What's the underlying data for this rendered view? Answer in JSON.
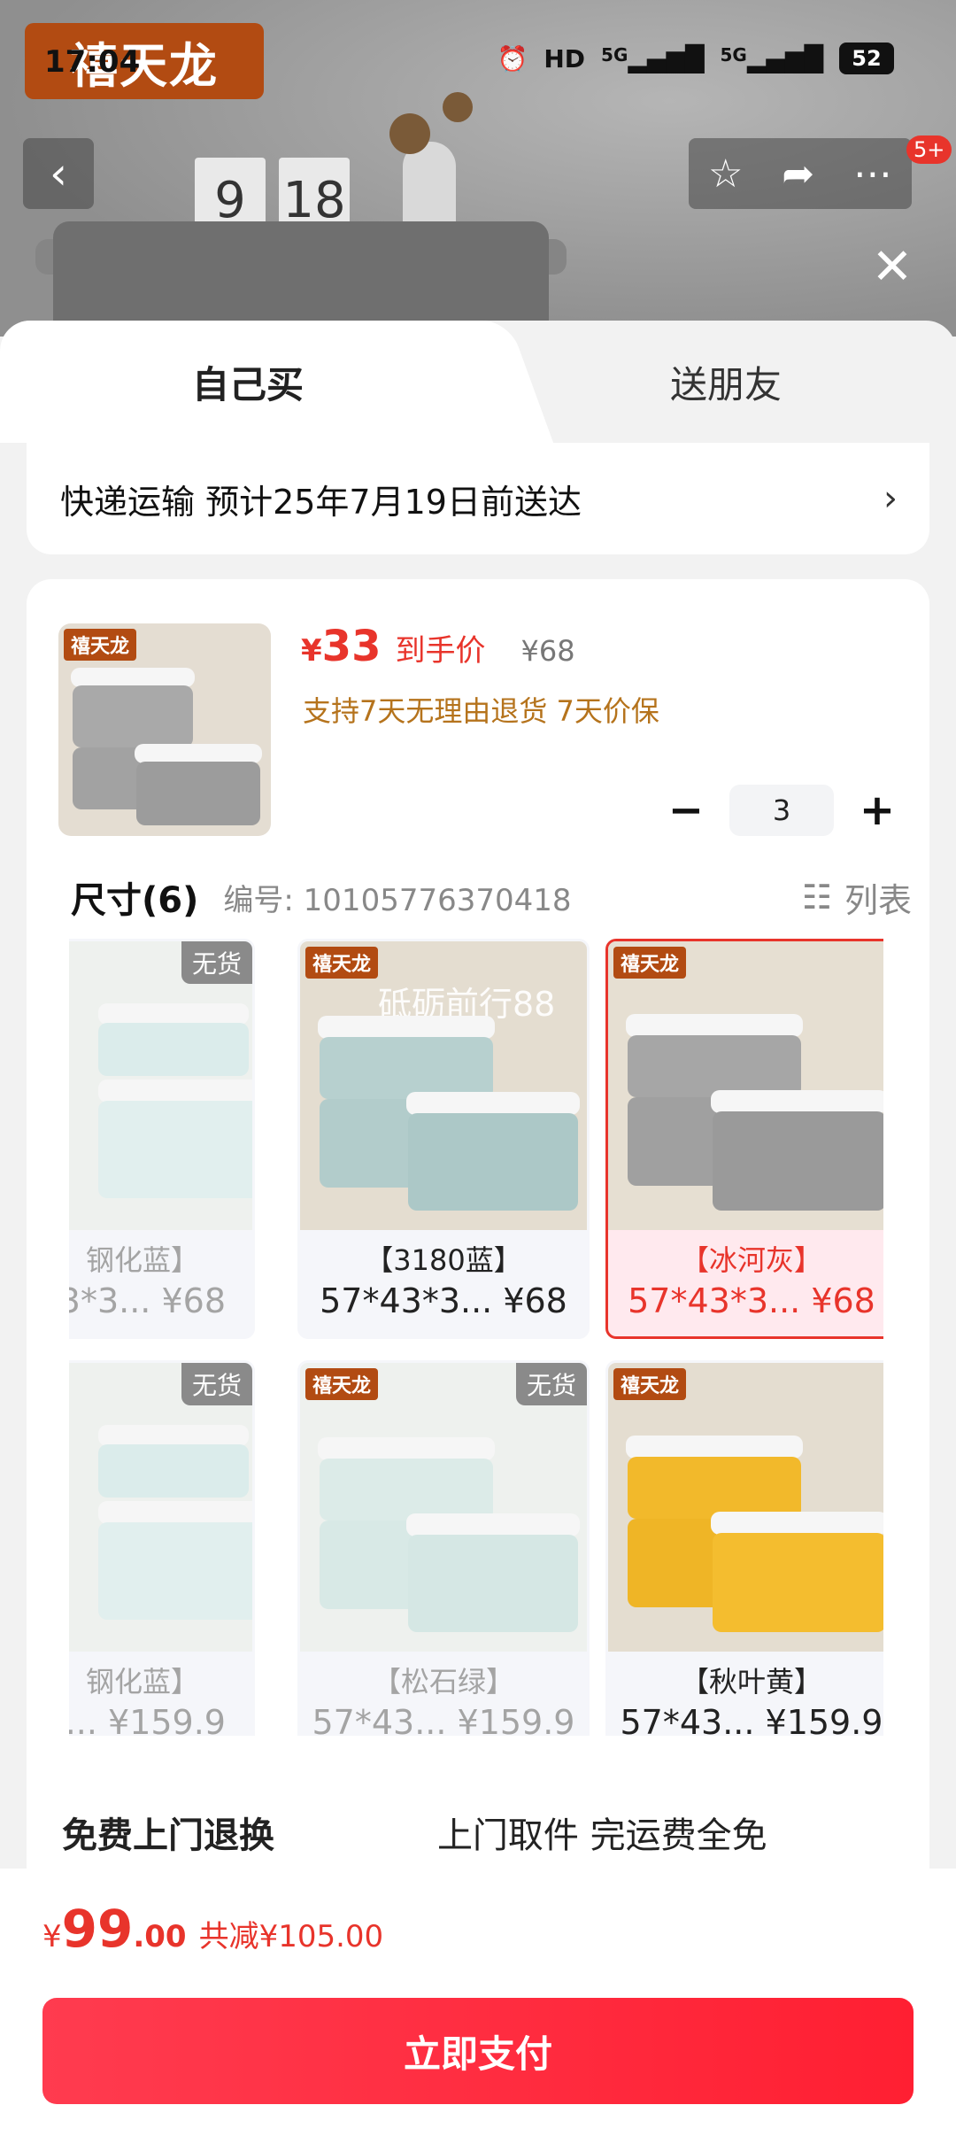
{
  "status_bar": {
    "time": "17:04",
    "hd": "HD",
    "net1": "5G",
    "net2": "5G",
    "battery": "52"
  },
  "header": {
    "brand": "禧天龙",
    "clock_hour": "9",
    "clock_min": "18",
    "notif_badge": "5+"
  },
  "tabs": [
    {
      "label": "自己买",
      "active": true
    },
    {
      "label": "送朋友",
      "active": false
    }
  ],
  "shipping": {
    "text": "快递运输 预计25年7月19日前送达"
  },
  "product": {
    "price_yen": "¥",
    "price": "33",
    "price_tag": "到手价",
    "original_price": "¥68",
    "guarantee": "支持7天无理由退货 7天价保",
    "quantity": "3"
  },
  "size_section": {
    "title": "尺寸(6)",
    "code": "编号: 10105776370418",
    "list_label": "列表"
  },
  "options": [
    {
      "line1": "钢化蓝】",
      "line2": "3*3... ¥68",
      "no_stock": "无货",
      "state": "dim"
    },
    {
      "line1": "【3180蓝】",
      "line2": "57*43*3... ¥68",
      "watermark": "砥砺前行88",
      "state": "normal"
    },
    {
      "line1": "【冰河灰】",
      "line2": "57*43*3... ¥68",
      "state": "selected"
    },
    {
      "line1": "钢化蓝】",
      "line2": "3... ¥159.9",
      "no_stock": "无货",
      "state": "dim"
    },
    {
      "line1": "【松石绿】",
      "line2": "57*43... ¥159.9",
      "no_stock": "无货",
      "state": "dim"
    },
    {
      "line1": "【秋叶黄】",
      "line2": "57*43... ¥159.9",
      "state": "normal"
    }
  ],
  "mini_logo": "禧天龙",
  "cutoff": {
    "left": "免费上门退换",
    "right": "上门取件 完运费全免"
  },
  "bottom": {
    "yen": "¥",
    "int": "99",
    "dec": ".00",
    "saved": "共减¥105.00",
    "pay_label": "立即支付"
  },
  "colors": {
    "accent": "#e8342b",
    "guarantee": "#b5731c"
  }
}
